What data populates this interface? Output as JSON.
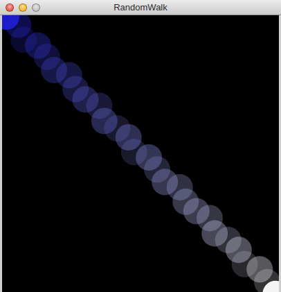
{
  "window": {
    "title": "RandomWalk",
    "buttons": [
      {
        "kind": "close",
        "color": "#ee5a52"
      },
      {
        "kind": "minimize",
        "color": "#f5b935"
      },
      {
        "kind": "zoom",
        "color": "#c6c6c6"
      }
    ]
  },
  "canvas": {
    "trail": {
      "steps": 28,
      "from_color": "#1a1acc",
      "to_color": "#f4f4f4"
    }
  }
}
